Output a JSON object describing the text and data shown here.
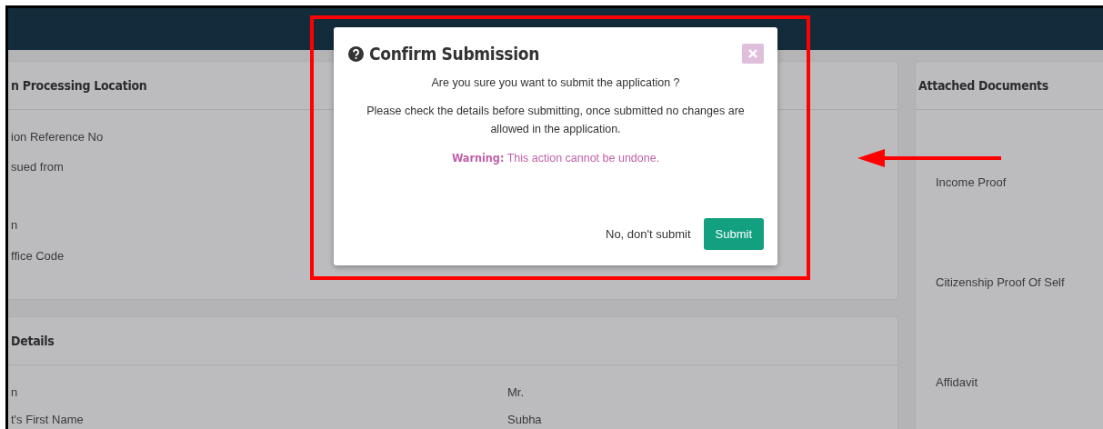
{
  "location_card": {
    "title": "n Processing Location",
    "rows": [
      {
        "label": "ion Reference No"
      },
      {
        "label": "sued from"
      },
      {
        "label": "n"
      },
      {
        "label": "ffice Code"
      }
    ]
  },
  "details_card": {
    "title": "Details",
    "rows": [
      {
        "label": "n",
        "value": "Mr."
      },
      {
        "label": "t's First Name",
        "value": "Subha"
      }
    ]
  },
  "attached_documents": {
    "title": "Attached Documents",
    "items": [
      "Income Proof",
      "Citizenship Proof Of Self",
      "Affidavit"
    ]
  },
  "dialog": {
    "title": "Confirm Submission",
    "question": "Are you sure you want to submit the application ?",
    "note": "Please check the details before submitting, once submitted no changes are allowed in the application.",
    "warning": "**Warning:** This action cannot be undone.",
    "buttons": [
      {
        "label": "No, don't submit",
        "kind": "link"
      },
      {
        "label": "Submit",
        "kind": "primary"
      }
    ]
  }
}
